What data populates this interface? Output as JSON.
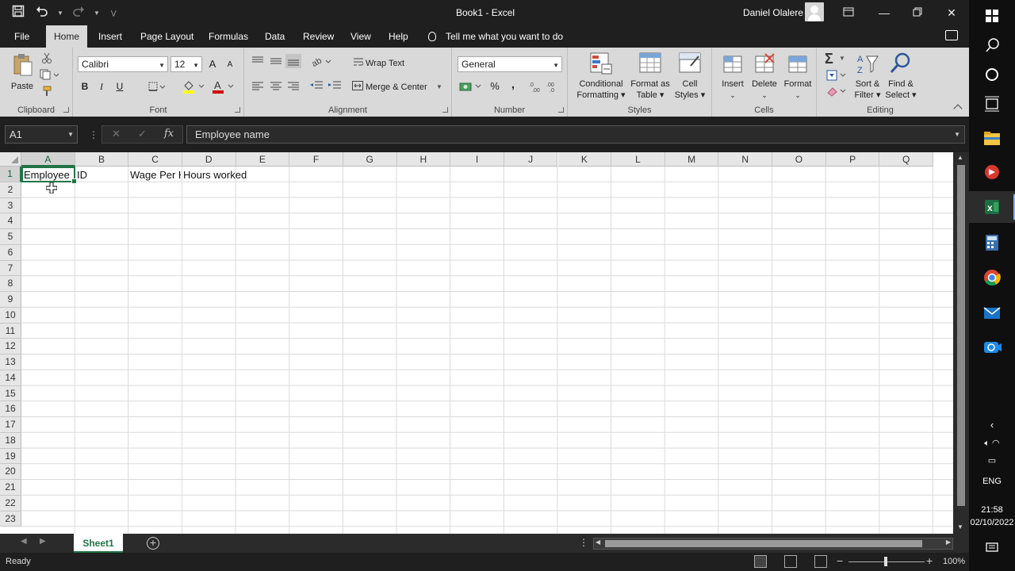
{
  "window": {
    "title": "Book1  -  Excel",
    "user": "Daniel Olalere"
  },
  "menu": {
    "tabs": [
      "File",
      "Home",
      "Insert",
      "Page Layout",
      "Formulas",
      "Data",
      "Review",
      "View",
      "Help"
    ],
    "active_tab": "Home",
    "tell_me": "Tell me what you want to do"
  },
  "ribbon": {
    "clipboard": {
      "label": "Clipboard",
      "paste": "Paste"
    },
    "font": {
      "label": "Font",
      "name": "Calibri",
      "size": "12",
      "bold": "B",
      "italic": "I",
      "underline": "U",
      "grow": "A",
      "shrink": "A"
    },
    "alignment": {
      "label": "Alignment",
      "wrap_text": "Wrap Text",
      "merge_center": "Merge & Center"
    },
    "number": {
      "label": "Number",
      "format": "General",
      "percent": "%",
      "comma": ","
    },
    "styles": {
      "label": "Styles",
      "conditional": "Conditional",
      "conditional2": "Formatting",
      "format_table": "Format as",
      "format_table2": "Table",
      "cell_styles": "Cell",
      "cell_styles2": "Styles"
    },
    "cells": {
      "label": "Cells",
      "insert": "Insert",
      "delete": "Delete",
      "format": "Format"
    },
    "editing": {
      "label": "Editing",
      "sort": "Sort &",
      "sort2": "Filter",
      "find": "Find &",
      "find2": "Select"
    }
  },
  "formula_bar": {
    "name_box": "A1",
    "fx": "fx",
    "value": "Employee name"
  },
  "grid": {
    "columns": [
      "A",
      "B",
      "C",
      "D",
      "E",
      "F",
      "G",
      "H",
      "I",
      "J",
      "K",
      "L",
      "M",
      "N",
      "O",
      "P",
      "Q"
    ],
    "rows": [
      "1",
      "2",
      "3",
      "4",
      "5",
      "6",
      "7",
      "8",
      "9",
      "10",
      "11",
      "12",
      "13",
      "14",
      "15",
      "16",
      "17",
      "18",
      "19",
      "20",
      "21",
      "22",
      "23"
    ],
    "selected_column": "A",
    "selected_row": "1",
    "cells": {
      "A1": "Employee",
      "B1": "ID",
      "C1": "Wage Per H",
      "D1": "Hours worked"
    }
  },
  "sheets": {
    "tabs": [
      "Sheet1"
    ],
    "active": "Sheet1"
  },
  "status": {
    "text": "Ready",
    "zoom": "100%"
  },
  "taskbar": {
    "language": "ENG",
    "time": "21:58",
    "date": "02/10/2022"
  },
  "colors": {
    "excel_green": "#217346",
    "ribbon_bg": "#d9d9d9",
    "chrome_bg": "#1f1f1f"
  }
}
